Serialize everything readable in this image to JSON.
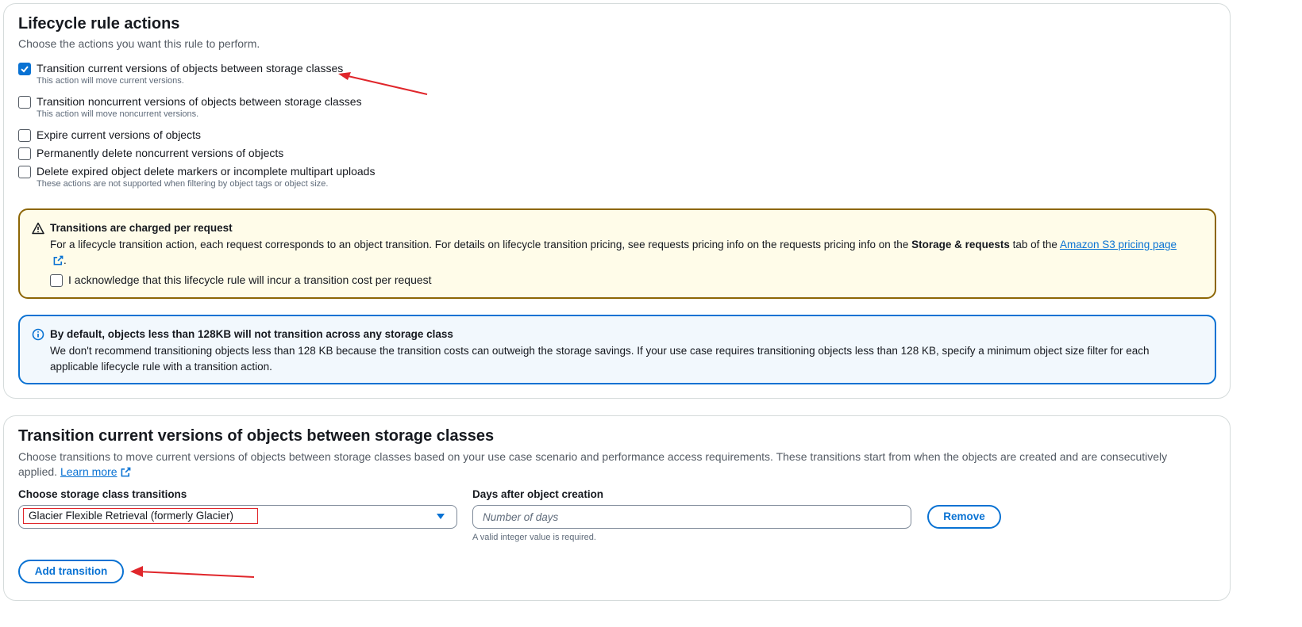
{
  "actions_panel": {
    "title": "Lifecycle rule actions",
    "description": "Choose the actions you want this rule to perform.",
    "options": [
      {
        "label": "Transition current versions of objects between storage classes",
        "sub": "This action will move current versions.",
        "checked": true
      },
      {
        "label": "Transition noncurrent versions of objects between storage classes",
        "sub": "This action will move noncurrent versions.",
        "checked": false
      },
      {
        "label": "Expire current versions of objects",
        "sub": "",
        "checked": false
      },
      {
        "label": "Permanently delete noncurrent versions of objects",
        "sub": "",
        "checked": false
      },
      {
        "label": "Delete expired object delete markers or incomplete multipart uploads",
        "sub": "These actions are not supported when filtering by object tags or object size.",
        "checked": false
      }
    ],
    "warning": {
      "title": "Transitions are charged per request",
      "body_prefix": "For a lifecycle transition action, each request corresponds to an object transition. For details on lifecycle transition pricing, see requests pricing info on the requests pricing info on the ",
      "body_bold": "Storage & requests",
      "body_middle": " tab of the ",
      "link_text": "Amazon S3 pricing page",
      "body_suffix": ".",
      "acknowledge_label": "I acknowledge that this lifecycle rule will incur a transition cost per request",
      "acknowledge_checked": false
    },
    "info": {
      "title": "By default, objects less than 128KB will not transition across any storage class",
      "body": "We don't recommend transitioning objects less than 128 KB because the transition costs can outweigh the storage savings. If your use case requires transitioning objects less than 128 KB, specify a minimum object size filter for each applicable lifecycle rule with a transition action."
    }
  },
  "transition_panel": {
    "title": "Transition current versions of objects between storage classes",
    "description": "Choose transitions to move current versions of objects between storage classes based on your use case scenario and performance access requirements. These transitions start from when the objects are created and are consecutively applied.",
    "learn_more": "Learn more",
    "storage_class_label": "Choose storage class transitions",
    "storage_class_value": "Glacier Flexible Retrieval (formerly Glacier)",
    "days_label": "Days after object creation",
    "days_placeholder": "Number of days",
    "days_hint": "A valid integer value is required.",
    "remove_label": "Remove",
    "add_transition_label": "Add transition"
  },
  "colors": {
    "accent": "#0972d3",
    "warning_border": "#8d6605",
    "warning_bg": "#fffce9",
    "info_bg": "#f2f8fd",
    "annotation_red": "#e0262b"
  },
  "icons": {
    "checkbox_checked": "check-icon",
    "warning": "warning-triangle-icon",
    "info": "info-circle-icon",
    "external": "external-link-icon",
    "dropdown": "caret-down-icon"
  }
}
